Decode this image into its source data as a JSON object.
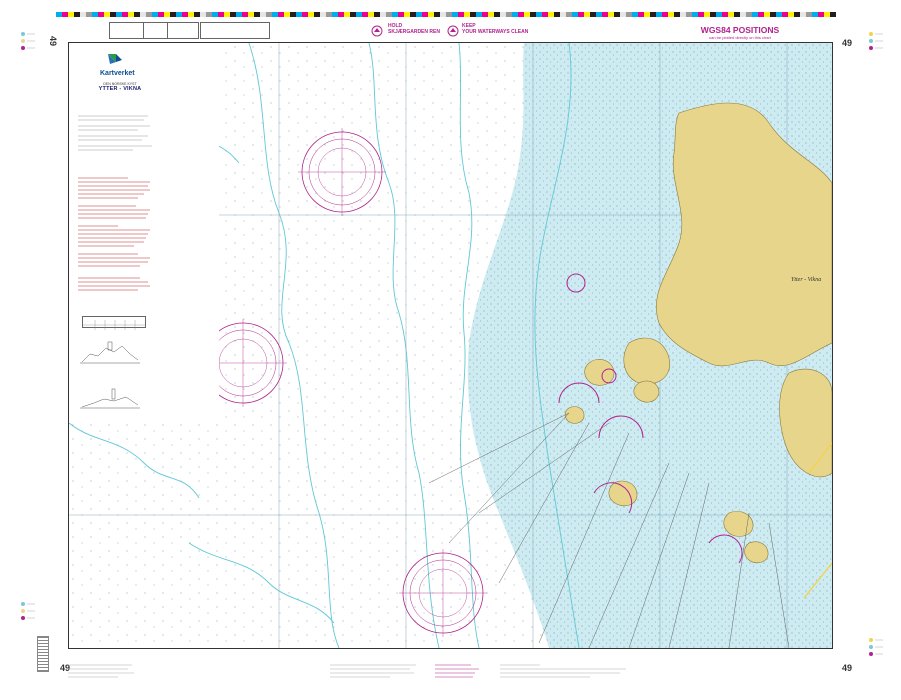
{
  "chart": {
    "number": "49",
    "publisher": "Kartverket",
    "series": "DEN NORSKE KYST",
    "title": "YTTER - VIKNA",
    "place_label": "Ytter - Vikna",
    "wgs84_title": "WGS84 POSITIONS",
    "wgs84_subtitle": "can be plotted directly on this chart",
    "env_no_line1": "HOLD",
    "env_no_line2": "SKJÆRGARDEN REN",
    "env_en_line1": "KEEP",
    "env_en_line2": "YOUR WATERWAYS CLEAN"
  },
  "colors": {
    "land": "#e8d58c",
    "shallow": "#bfe7ee",
    "depth_contour": "#5fc8d6",
    "magenta": "#b0228c",
    "frame": "#333333"
  }
}
